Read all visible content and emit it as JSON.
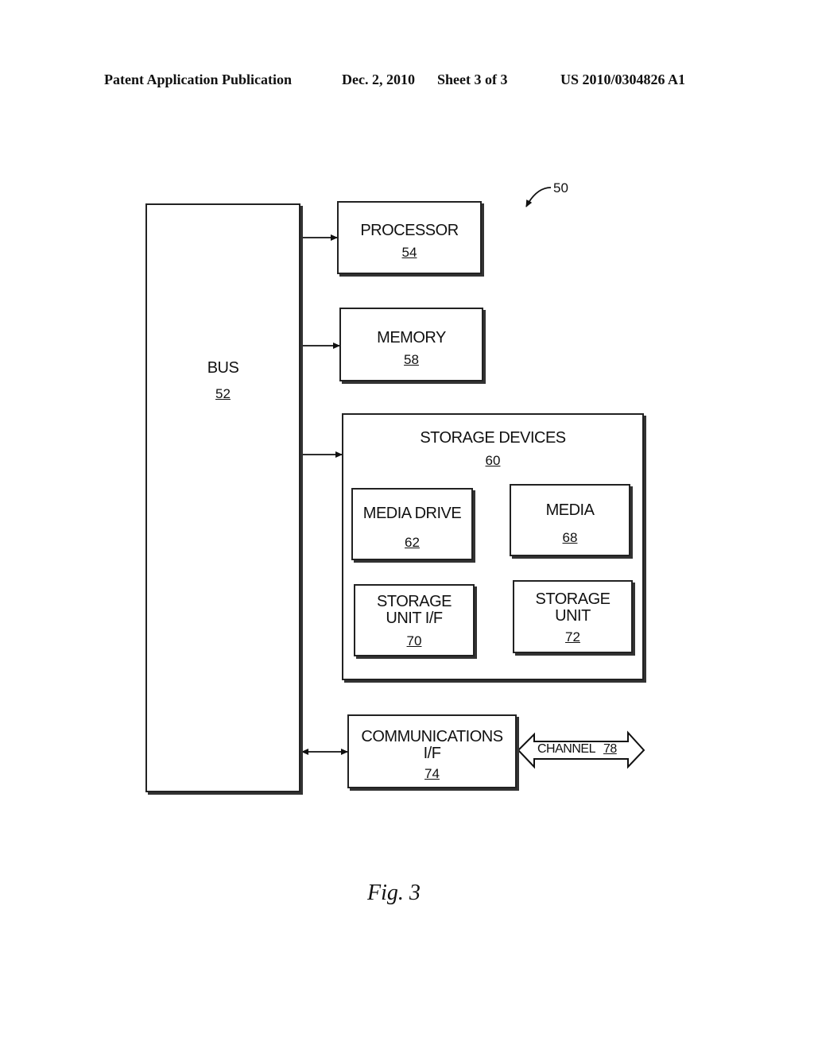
{
  "header": {
    "publication": "Patent Application Publication",
    "date": "Dec. 2, 2010",
    "sheet": "Sheet 3 of 3",
    "number": "US 2010/0304826 A1"
  },
  "diagram": {
    "system_ref": "50",
    "bus": {
      "label": "BUS",
      "ref": "52"
    },
    "processor": {
      "label": "PROCESSOR",
      "ref": "54"
    },
    "memory": {
      "label": "MEMORY",
      "ref": "58"
    },
    "storage_devices": {
      "label": "STORAGE DEVICES",
      "ref": "60"
    },
    "media_drive": {
      "label": "MEDIA DRIVE",
      "ref": "62"
    },
    "media": {
      "label": "MEDIA",
      "ref": "68"
    },
    "storage_unit_if": {
      "label_line1": "STORAGE",
      "label_line2": "UNIT I/F",
      "ref": "70"
    },
    "storage_unit": {
      "label_line1": "STORAGE",
      "label_line2": "UNIT",
      "ref": "72"
    },
    "comm_if": {
      "label_line1": "COMMUNICATIONS",
      "label_line2": "I/F",
      "ref": "74"
    },
    "channel": {
      "label": "CHANNEL",
      "ref": "78"
    }
  },
  "figure_caption": "Fig. 3"
}
